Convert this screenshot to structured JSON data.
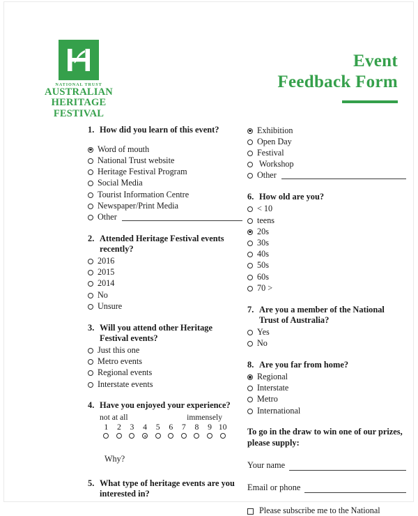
{
  "brand": {
    "accent_color": "#35a04b",
    "logo_mark_letter": "H",
    "logo_org": "NATIONAL TRUST",
    "logo_line1": "AUSTRALIAN",
    "logo_line2": "HERITAGE",
    "logo_line3": "FESTIVAL"
  },
  "header": {
    "title_line1": "Event",
    "title_line2": "Feedback Form"
  },
  "left_column": {
    "q1": {
      "number": "1.",
      "text": "How did you learn of this event?",
      "options": [
        {
          "label": "Word of mouth",
          "selected": true
        },
        {
          "label": "National Trust website",
          "selected": false
        },
        {
          "label": "Heritage Festival Program",
          "selected": false
        },
        {
          "label": "Social Media",
          "selected": false
        },
        {
          "label": "Tourist Information Centre",
          "selected": false
        },
        {
          "label": "Newspaper/Print Media",
          "selected": false
        },
        {
          "label": "Other",
          "selected": false,
          "has_line": true
        }
      ]
    },
    "q2": {
      "number": "2.",
      "text": "Attended Heritage Festival events recently?",
      "options": [
        {
          "label": "2016",
          "selected": false
        },
        {
          "label": "2015",
          "selected": false
        },
        {
          "label": "2014",
          "selected": false
        },
        {
          "label": "No",
          "selected": false
        },
        {
          "label": "Unsure",
          "selected": false
        }
      ]
    },
    "q3": {
      "number": "3.",
      "text": "Will you attend other Heritage Festival events?",
      "options": [
        {
          "label": "Just this one",
          "selected": false
        },
        {
          "label": "Metro events",
          "selected": false
        },
        {
          "label": "Regional events",
          "selected": false
        },
        {
          "label": "Interstate events",
          "selected": false
        }
      ]
    },
    "q4": {
      "number": "4.",
      "text": "Have you enjoyed your experience?",
      "low_label": "not at all",
      "high_label": "immensely",
      "scale": [
        "1",
        "2",
        "3",
        "4",
        "5",
        "6",
        "7",
        "8",
        "9",
        "10"
      ],
      "selected_value": "4",
      "followup": "Why?"
    },
    "q5": {
      "number": "5.",
      "text": "What type of heritage events are you interested in?"
    }
  },
  "right_column": {
    "q5_options": [
      {
        "label": "Exhibition",
        "selected": true
      },
      {
        "label": "Open Day",
        "selected": false
      },
      {
        "label": "Festival",
        "selected": false
      },
      {
        "label": " Workshop",
        "selected": false
      },
      {
        "label": "Other",
        "selected": false,
        "has_line": true
      }
    ],
    "q6": {
      "number": "6.",
      "text": "How old are you?",
      "options": [
        {
          "label": "< 10",
          "selected": false
        },
        {
          "label": "teens",
          "selected": false
        },
        {
          "label": "20s",
          "selected": true
        },
        {
          "label": "30s",
          "selected": false
        },
        {
          "label": "40s",
          "selected": false
        },
        {
          "label": "50s",
          "selected": false
        },
        {
          "label": "60s",
          "selected": false
        },
        {
          "label": "70 >",
          "selected": false
        }
      ]
    },
    "q7": {
      "number": "7.",
      "text": "Are you a member of the National Trust of Australia?",
      "options": [
        {
          "label": "Yes",
          "selected": false
        },
        {
          "label": "No",
          "selected": false
        }
      ]
    },
    "q8": {
      "number": "8.",
      "text": "Are you far from home?",
      "options": [
        {
          "label": "Regional",
          "selected": true
        },
        {
          "label": "Interstate",
          "selected": false
        },
        {
          "label": "Metro",
          "selected": false
        },
        {
          "label": "International",
          "selected": false
        }
      ]
    },
    "prize": {
      "heading": "To go in the draw to win one of our prizes, please supply:",
      "name_label": "Your name",
      "name_value": "",
      "contact_label": "Email or phone",
      "contact_value": "",
      "subscribe_label": "Please subscribe me to the National",
      "subscribe_checked": false
    }
  }
}
